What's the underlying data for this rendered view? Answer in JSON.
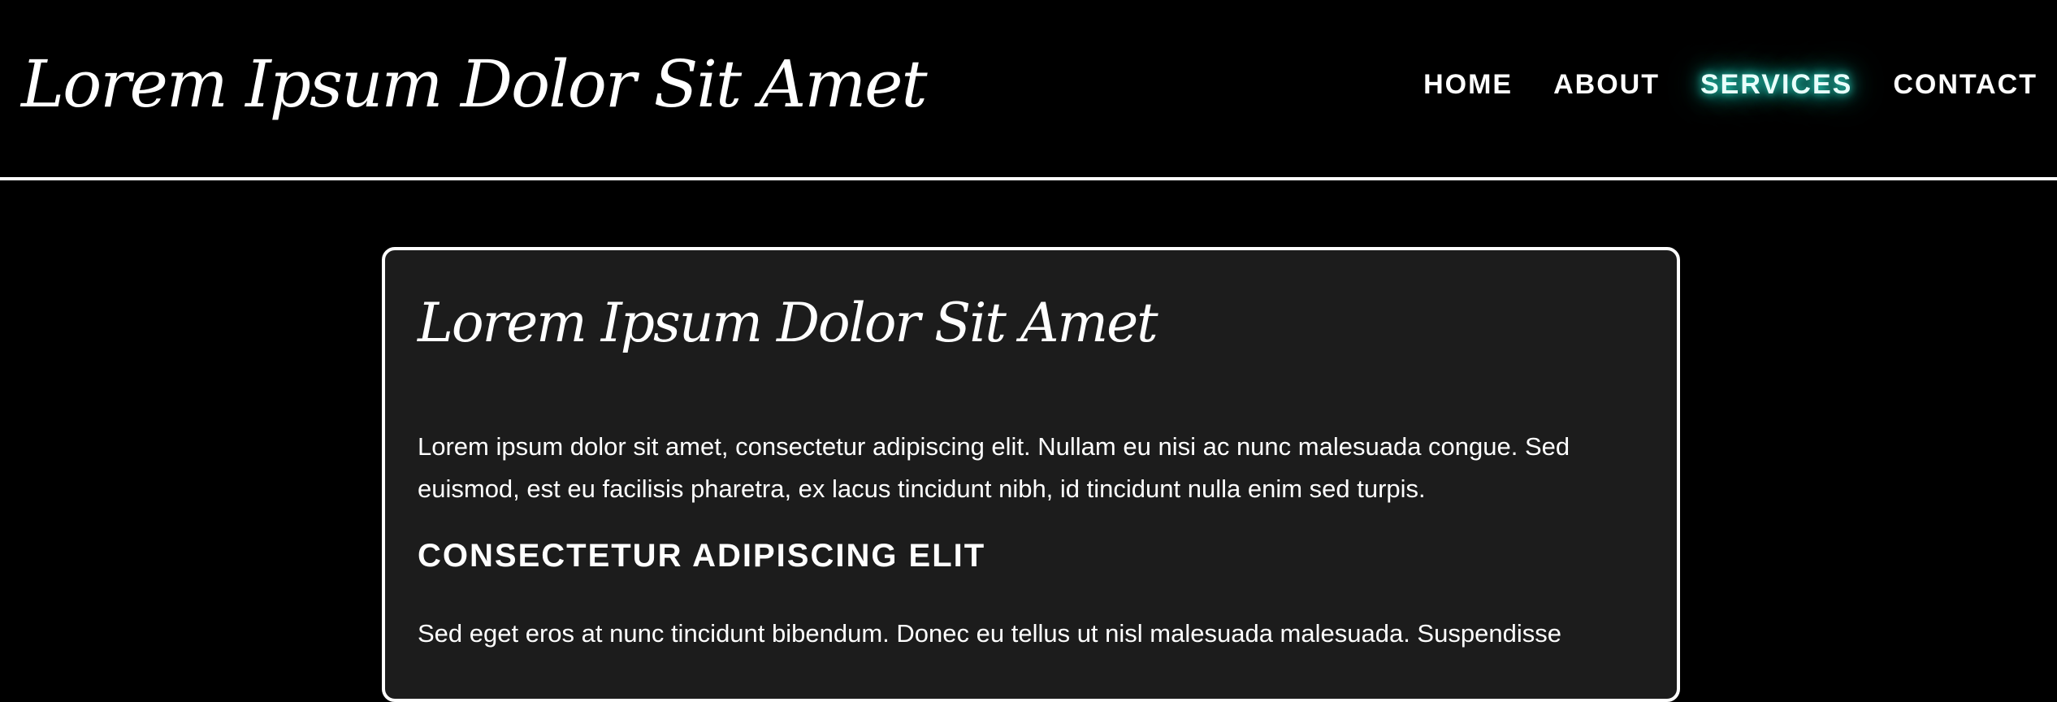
{
  "header": {
    "site_title": "Lorem Ipsum Dolor Sit Amet",
    "nav": [
      {
        "label": "HOME",
        "active": false
      },
      {
        "label": "ABOUT",
        "active": false
      },
      {
        "label": "SERVICES",
        "active": true
      },
      {
        "label": "CONTACT",
        "active": false
      }
    ]
  },
  "main": {
    "title": "Lorem Ipsum Dolor Sit Amet",
    "paragraph_1": "Lorem ipsum dolor sit amet, consectetur adipiscing elit. Nullam eu nisi ac nunc malesuada congue. Sed euismod, est eu facilisis pharetra, ex lacus tincidunt nibh, id tincidunt nulla enim sed turpis.",
    "section_heading": "CONSECTETUR ADIPISCING ELIT",
    "paragraph_2": "Sed eget eros at nunc tincidunt bibendum. Donec eu tellus ut nisl malesuada malesuada. Suspendisse"
  },
  "colors": {
    "background": "#000000",
    "card_background": "#1c1c1c",
    "text": "#ffffff",
    "active_glow": "#2ad4c0"
  }
}
